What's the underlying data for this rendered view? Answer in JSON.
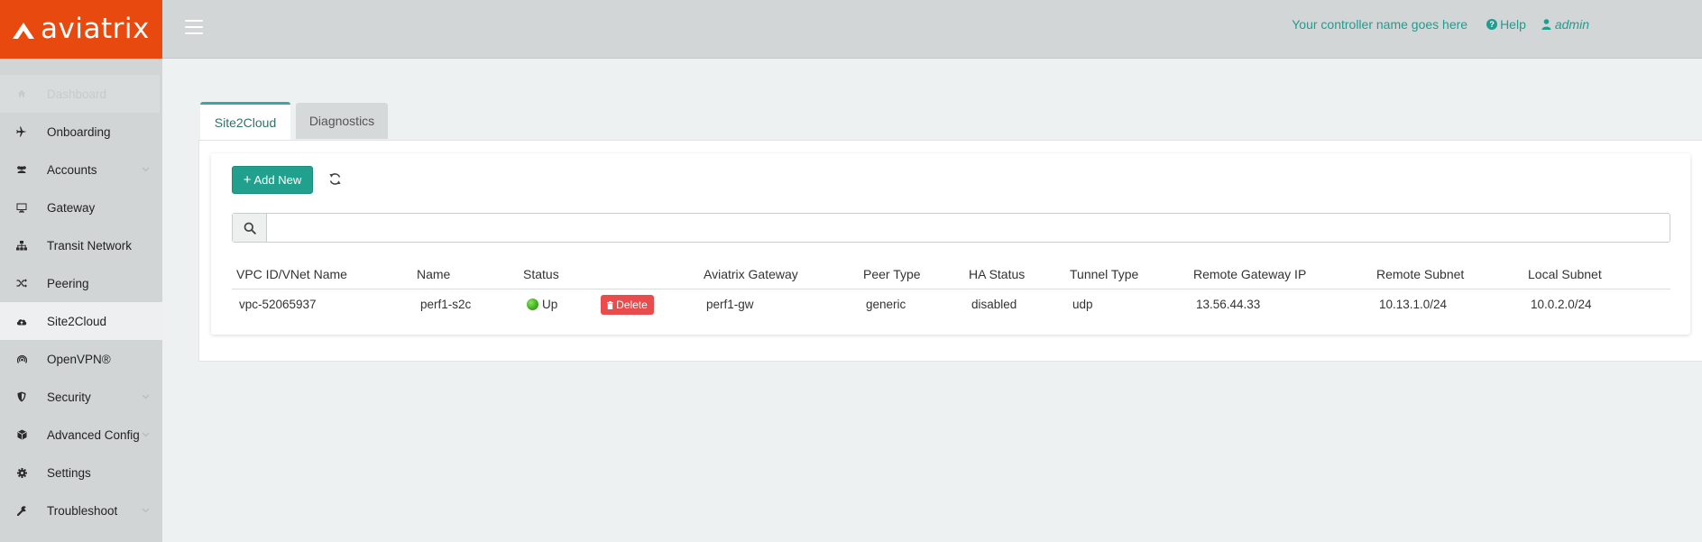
{
  "brand": {
    "name": "aviatrix",
    "color": "#e8490f"
  },
  "header": {
    "controller_name": "Your controller name goes here",
    "help_label": "Help",
    "user_label": "admin"
  },
  "sidebar": {
    "items": [
      {
        "label": "Dashboard",
        "icon": "home-icon"
      },
      {
        "label": "Onboarding",
        "icon": "plane-icon"
      },
      {
        "label": "Accounts",
        "icon": "users-icon"
      },
      {
        "label": "Gateway",
        "icon": "monitor-icon"
      },
      {
        "label": "Transit Network",
        "icon": "sitemap-icon"
      },
      {
        "label": "Peering",
        "icon": "shuffle-icon"
      },
      {
        "label": "Site2Cloud",
        "icon": "cloud-upload-icon"
      },
      {
        "label": "OpenVPN®",
        "icon": "wifi-icon"
      },
      {
        "label": "Security",
        "icon": "shield-icon"
      },
      {
        "label": "Advanced Config",
        "icon": "cube-icon"
      },
      {
        "label": "Settings",
        "icon": "gear-icon"
      },
      {
        "label": "Troubleshoot",
        "icon": "wrench-icon"
      }
    ]
  },
  "tabs": [
    {
      "label": "Site2Cloud"
    },
    {
      "label": "Diagnostics"
    }
  ],
  "toolbar": {
    "add_label": "Add New"
  },
  "search": {
    "placeholder": "",
    "value": ""
  },
  "table": {
    "columns": [
      "VPC ID/VNet Name",
      "Name",
      "Status",
      "Aviatrix Gateway",
      "Peer Type",
      "HA Status",
      "Tunnel Type",
      "Remote Gateway IP",
      "Remote Subnet",
      "Local Subnet"
    ],
    "rows": [
      {
        "vpc": "vpc-52065937",
        "name": "perf1-s2c",
        "status": "Up",
        "delete_label": "Delete",
        "gateway": "perf1-gw",
        "peer_type": "generic",
        "ha_status": "disabled",
        "tunnel_type": "udp",
        "remote_ip": "13.56.44.33",
        "remote_subnet": "10.13.1.0/24",
        "local_subnet": "10.0.2.0/24"
      }
    ]
  },
  "colors": {
    "accent": "#22a08e",
    "danger": "#e84c4c",
    "status_up": "#3fb21c"
  }
}
